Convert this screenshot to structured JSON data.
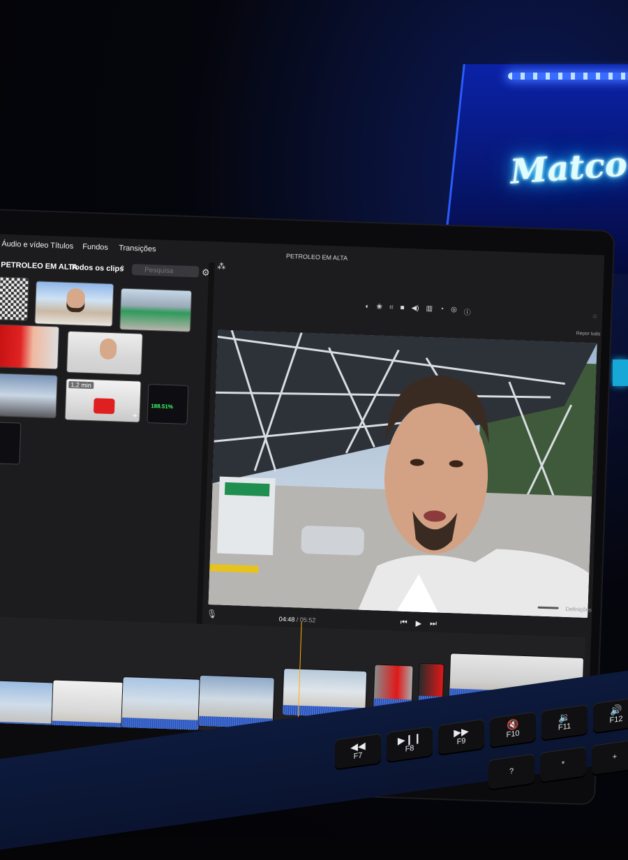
{
  "neon_sign": "Matco",
  "app": {
    "window_title": "PETROLEO EM ALTA",
    "tabs": [
      "Áudio e vídeo",
      "Títulos",
      "Fundos",
      "Transições"
    ],
    "library": {
      "project_name": "PETROLEO EM ALTA",
      "filter": "Todos os clips",
      "search_placeholder": "Pesquisa"
    },
    "browser_badges": {
      "duration": "1,2 min",
      "stat": "188.51%"
    },
    "viewer": {
      "toolbar_icons": [
        "color-balance-icon",
        "color-correction-icon",
        "crop-icon",
        "stabilization-icon",
        "volume-icon",
        "noise-reduction-icon",
        "speed-icon",
        "filter-icon",
        "info-icon"
      ],
      "reset_label": "Repor tudo",
      "settings_label": "Definições"
    },
    "timecode": {
      "current": "04:48",
      "separator": "/",
      "total": "05:52"
    }
  },
  "keyboard": {
    "keys": [
      {
        "glyph": "◀◀",
        "label": "F7"
      },
      {
        "glyph": "▶❙❙",
        "label": "F8"
      },
      {
        "glyph": "▶▶",
        "label": "F9"
      },
      {
        "glyph": "🔇",
        "label": "F10"
      },
      {
        "glyph": "🔉",
        "label": "F11"
      },
      {
        "glyph": "🔊",
        "label": "F12"
      }
    ],
    "bottom_keys": [
      "?",
      "*",
      "+"
    ]
  },
  "colors": {
    "accent_audio": "#2a52b8",
    "playhead": "#ffb000",
    "neon": "#36d8ff"
  }
}
